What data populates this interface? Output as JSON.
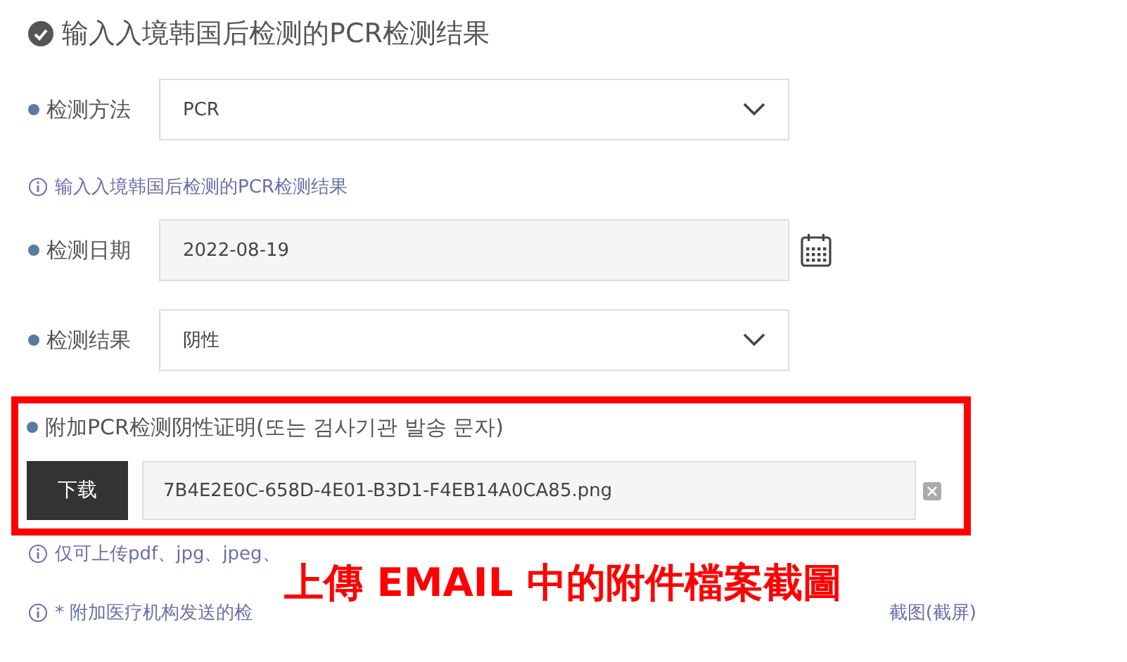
{
  "title": "输入入境韩国后检测的PCR检测结果",
  "method": {
    "label": "检测方法",
    "value": "PCR"
  },
  "method_hint": "输入入境韩国后检测的PCR检测结果",
  "date": {
    "label": "检测日期",
    "value": "2022-08-19"
  },
  "result": {
    "label": "检测结果",
    "value": "阴性"
  },
  "attachment": {
    "label": "附加PCR检测阴性证明(또는 검사기관 발송 문자)",
    "button": "下载",
    "filename": "7B4E2E0C-658D-4E01-B3D1-F4EB14A0CA85.png"
  },
  "hints": [
    {
      "left": "仅可上传pdf、jpg、jpeg、"
    },
    {
      "left": "* 附加医疗机构发送的检",
      "right": "截图(截屏)"
    }
  ],
  "annotation": "上傳 EMAIL 中的附件檔案截圖"
}
